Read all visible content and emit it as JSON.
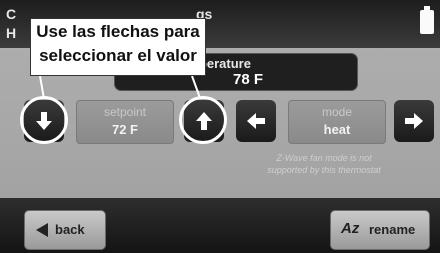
{
  "title": {
    "line1": "C",
    "line2": "H",
    "tail": "gs"
  },
  "temperature": {
    "label": "nperature",
    "value": "78 F"
  },
  "setpoint": {
    "label": "setpoint",
    "value": "72 F"
  },
  "mode": {
    "label": "mode",
    "value": "heat"
  },
  "note": {
    "line1": "Z-Wave fan mode is not",
    "line2": "supported by this thermostat"
  },
  "footer": {
    "back_label": "back",
    "rename_label": "rename",
    "rename_icon": "Az"
  },
  "callout": {
    "line1": "Use las flechas para",
    "line2": "seleccionar el valor"
  },
  "icons": {
    "down": "down-arrow-icon",
    "up": "up-arrow-icon",
    "left": "left-arrow-icon",
    "right": "right-arrow-icon",
    "battery": "battery-icon",
    "back": "back-triangle-icon",
    "rename": "az-rename-icon"
  },
  "colors": {
    "screen_bg": "#a6a6a6",
    "title_bg": "#2b2b2b",
    "highlight": "#ffffff"
  }
}
